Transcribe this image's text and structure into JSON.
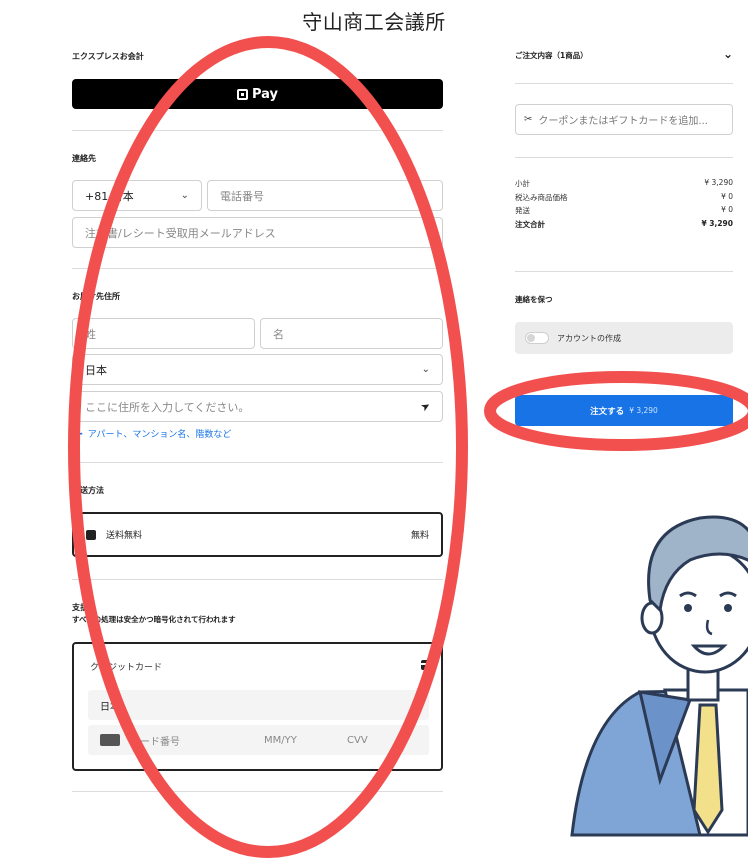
{
  "shop": {
    "title": "守山商工会議所"
  },
  "express": {
    "label": "エクスプレスお会計",
    "pay_button": "Pay"
  },
  "contact": {
    "label": "連絡先",
    "country_code": "+81 日本",
    "phone_placeholder": "電話番号",
    "email_placeholder": "注文書/レシート受取用メールアドレス"
  },
  "shipping_address": {
    "label": "お届け先住所",
    "last_name_placeholder": "姓",
    "first_name_placeholder": "名",
    "country": "日本",
    "address_placeholder": "ここに住所を入力してください。",
    "add_apartment": "アパート、マンション名、階数など"
  },
  "delivery": {
    "label": "配送方法",
    "option": "送料無料",
    "price": "無料"
  },
  "payment": {
    "label": "支払い",
    "note": "すべての処理は安全かつ暗号化されて行われます",
    "method": "クレジットカード",
    "country": "日本",
    "card_number_placeholder": "カード番号",
    "expiry_placeholder": "MM/YY",
    "cvv_placeholder": "CVV"
  },
  "summary": {
    "toggle_label": "ご注文内容（1商品）",
    "coupon_placeholder": "クーポンまたはギフトカードを追加...",
    "rows": [
      {
        "label": "小計",
        "value": "¥ 3,290"
      },
      {
        "label": "税込み商品価格",
        "value": "¥ 0"
      },
      {
        "label": "発送",
        "value": "¥ 0"
      },
      {
        "label": "注文合計",
        "value": "¥ 3,290"
      }
    ]
  },
  "account": {
    "label": "連絡を保つ",
    "toggle_label": "アカウントの作成"
  },
  "order_button": {
    "label": "注文する",
    "amount": "¥ 3,290"
  },
  "colors": {
    "accent": "#1773e6",
    "annotation": "#f2504f"
  }
}
